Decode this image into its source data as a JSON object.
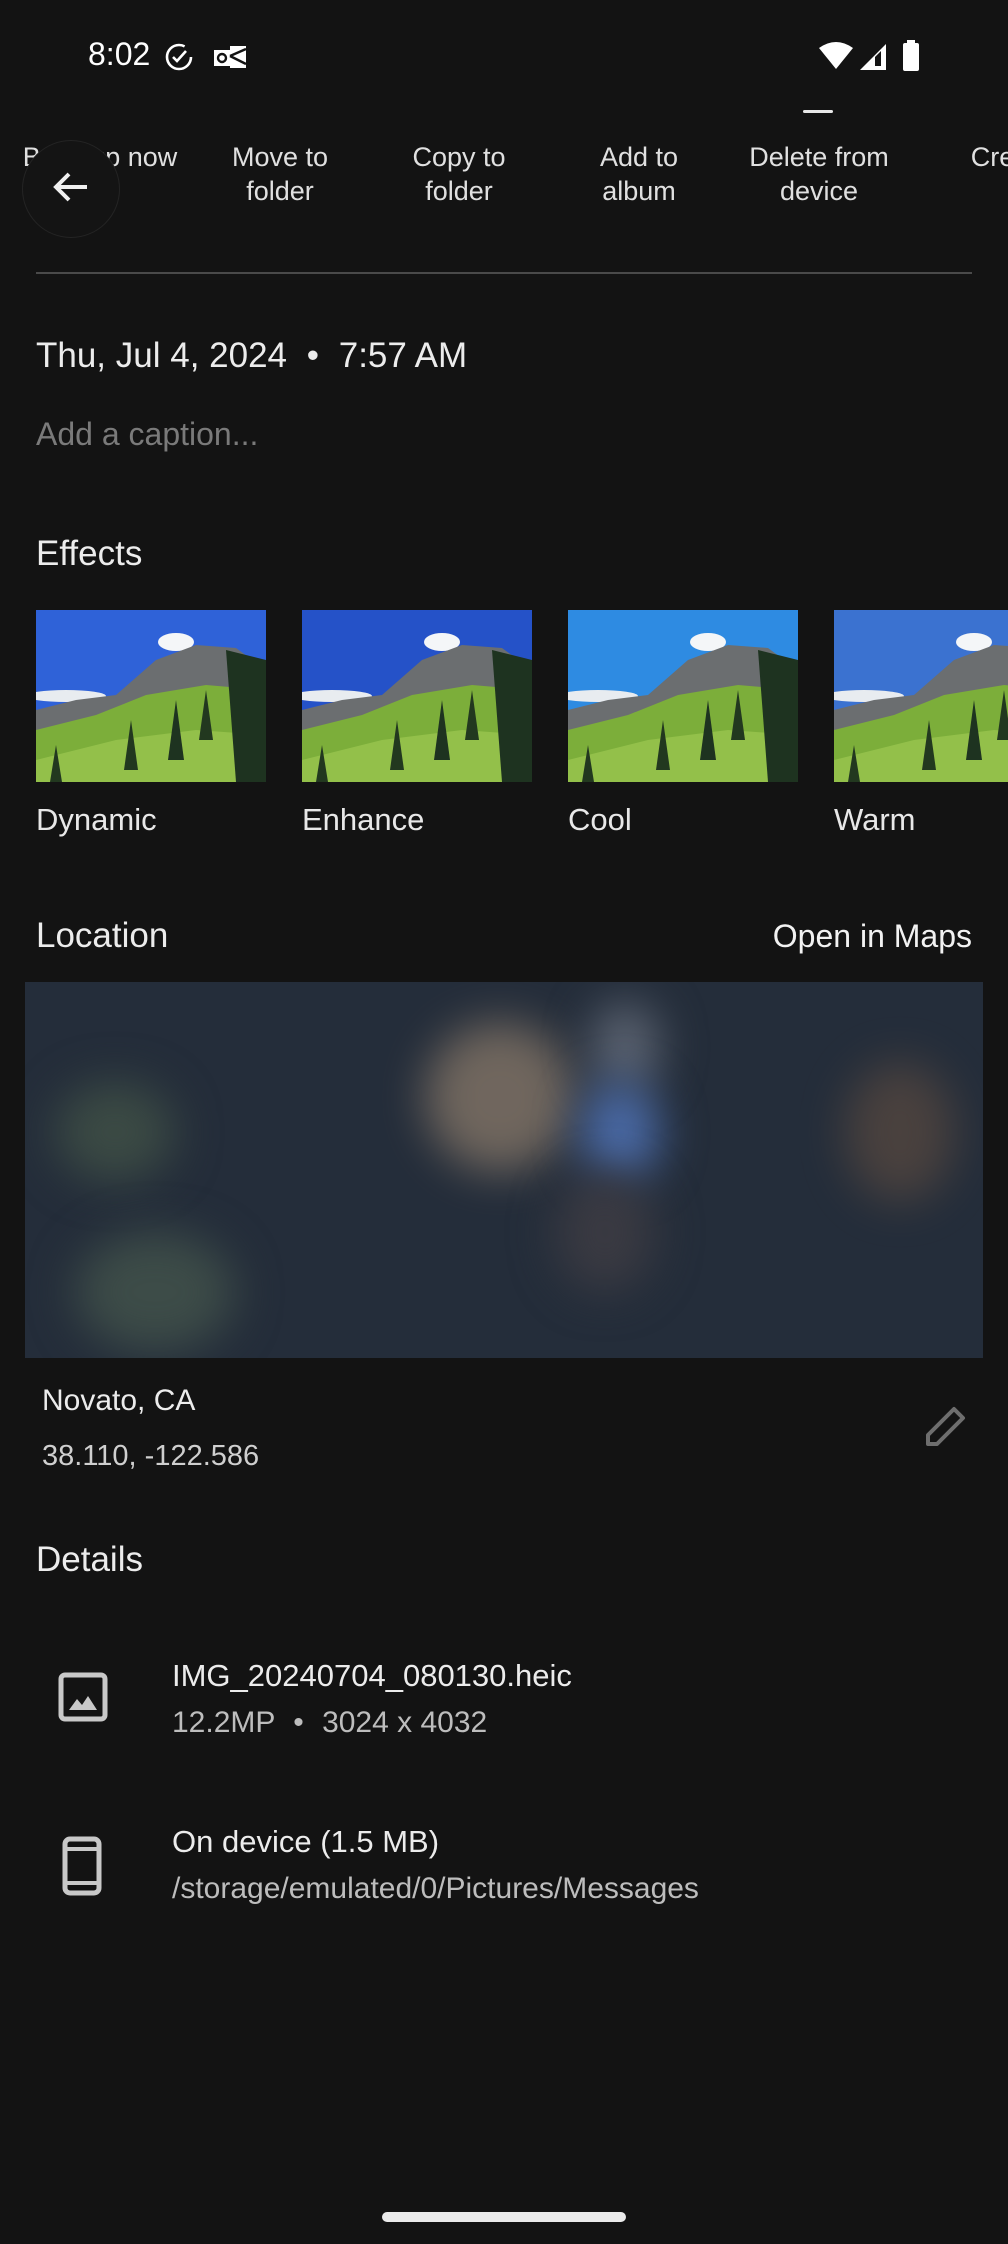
{
  "status_bar": {
    "time": "8:02",
    "left_icons": [
      "task-check-icon",
      "outlook-icon"
    ],
    "right_icons": [
      "wifi-icon",
      "cell-signal-icon",
      "battery-icon"
    ]
  },
  "actions": [
    {
      "label": "Back up now"
    },
    {
      "label": "Move to\nfolder"
    },
    {
      "label": "Copy to\nfolder"
    },
    {
      "label": "Add to\nalbum"
    },
    {
      "label": "Delete from\ndevice"
    },
    {
      "label": "Crea"
    }
  ],
  "back_button": {
    "icon": "arrow-back-icon"
  },
  "info": {
    "date": "Thu, Jul 4, 2024",
    "separator": "•",
    "time": "7:57 AM",
    "caption_placeholder": "Add a caption..."
  },
  "effects": {
    "title": "Effects",
    "items": [
      {
        "label": "Dynamic",
        "sky": "#2f62d8"
      },
      {
        "label": "Enhance",
        "sky": "#2552c8"
      },
      {
        "label": "Cool",
        "sky": "#2e8be2"
      },
      {
        "label": "Warm",
        "sky": "#3b72d0"
      }
    ]
  },
  "location": {
    "title": "Location",
    "open_maps_label": "Open in Maps",
    "place": "Novato, CA",
    "coordinates": "38.110, -122.586",
    "edit_icon": "pencil-icon"
  },
  "details": {
    "title": "Details",
    "file": {
      "name": "IMG_20240704_080130.heic",
      "megapixels": "12.2MP",
      "separator": "•",
      "resolution": "3024 x 4032"
    },
    "storage": {
      "title": "On device (1.5 MB)",
      "path": "/storage/emulated/0/Pictures/Messages"
    }
  }
}
